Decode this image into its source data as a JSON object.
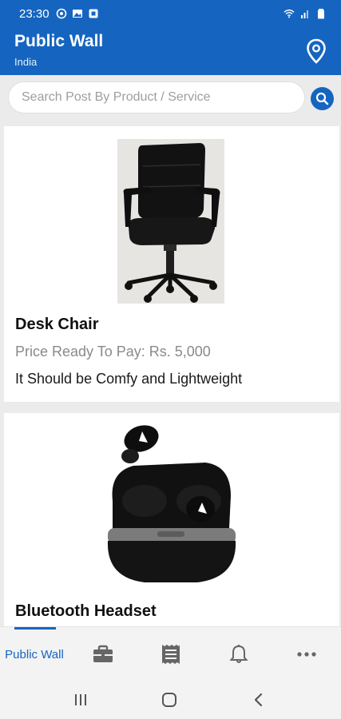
{
  "status_bar": {
    "time": "23:30"
  },
  "app_bar": {
    "title": "Public Wall",
    "subtitle": "India"
  },
  "search": {
    "placeholder": "Search Post By Product / Service"
  },
  "posts": [
    {
      "title": "Desk Chair",
      "price": "Price Ready To Pay: Rs. 5,000",
      "description": "It Should be Comfy and Lightweight"
    },
    {
      "title": "Bluetooth Headset"
    }
  ],
  "bottom_nav": {
    "active_label": "Public Wall"
  },
  "colors": {
    "primary": "#1565c0",
    "background": "#ebebeb",
    "price": "#8a8a8a"
  }
}
